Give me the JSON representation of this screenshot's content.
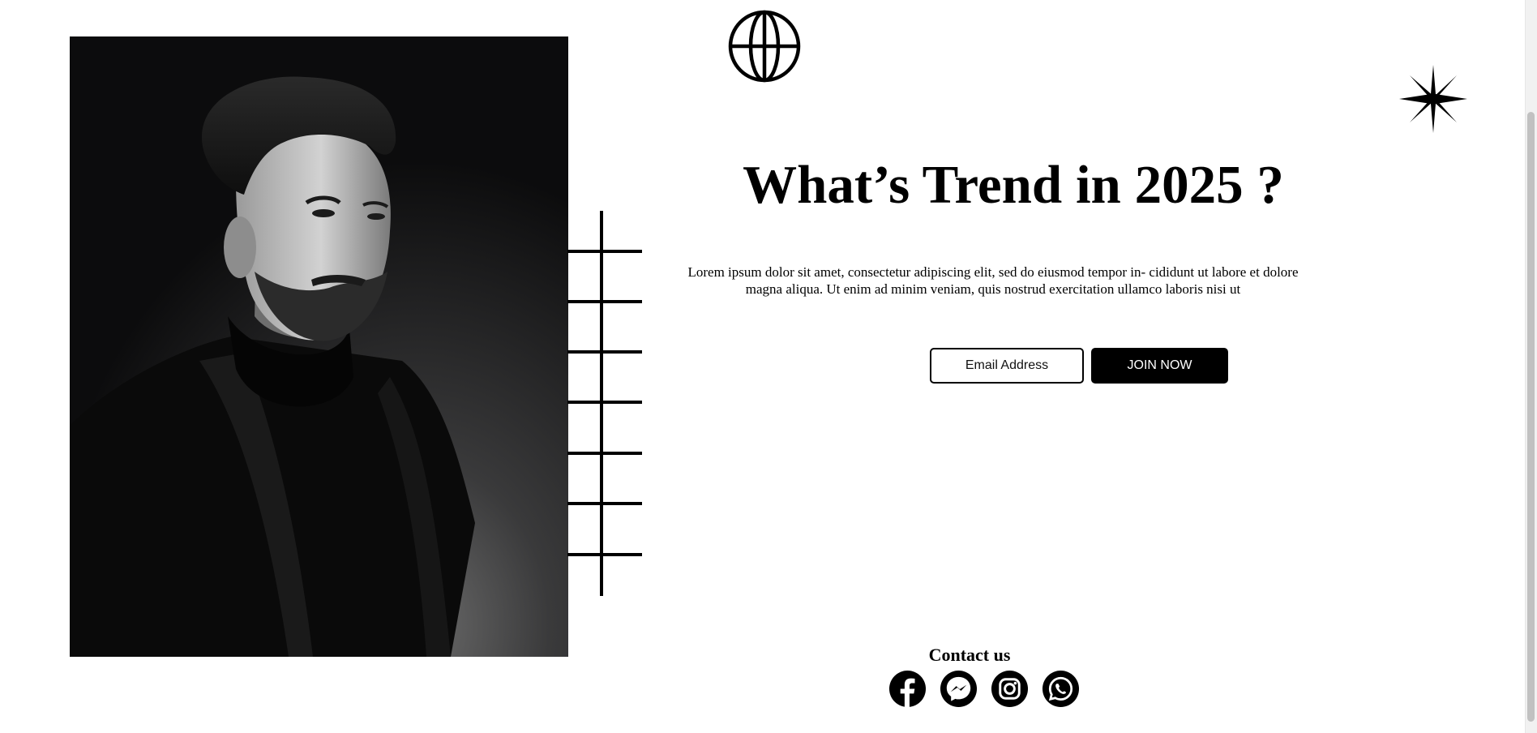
{
  "hero": {
    "headline": "What’s Trend in 2025 ?",
    "description": "Lorem ipsum dolor sit amet, consectetur adipiscing elit, sed do eiusmod tempor in- cididunt ut labore et dolore magna aliqua. Ut enim ad minim veniam, quis nostrud exercitation ullamco laboris nisi ut"
  },
  "signup": {
    "email_placeholder": "Email Address",
    "join_label": "JOIN NOW"
  },
  "contact": {
    "heading": "Contact us",
    "icons": [
      "facebook-icon",
      "messenger-icon",
      "instagram-icon",
      "whatsapp-icon"
    ]
  },
  "decorations": {
    "top_icon": "globe-icon",
    "corner_icon": "star-icon",
    "photo": "portrait-photo"
  },
  "colors": {
    "background": "#ffffff",
    "text": "#000000",
    "button_bg": "#000000",
    "button_text": "#ffffff"
  }
}
